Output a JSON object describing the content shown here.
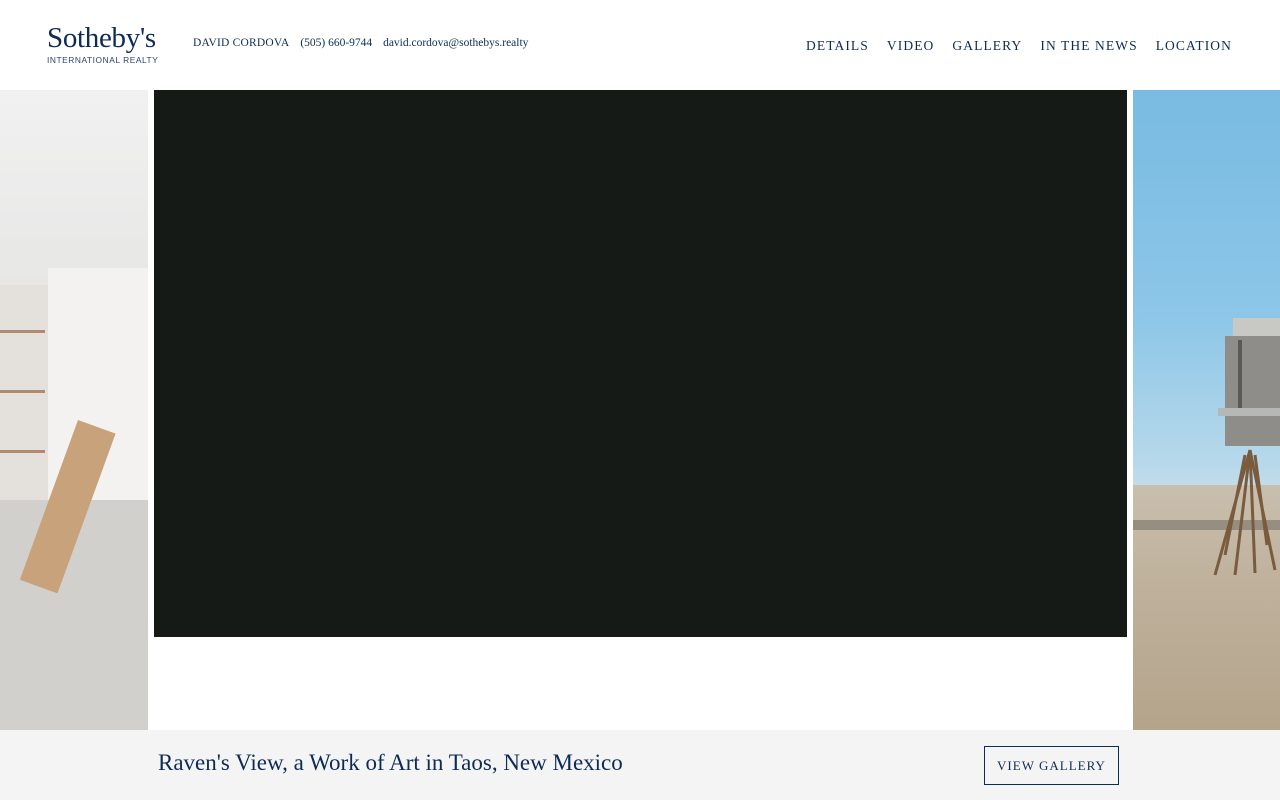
{
  "brand": {
    "wordmark": "Sotheby's",
    "subtitle": "INTERNATIONAL REALTY",
    "color": "#0e2b55"
  },
  "agent": {
    "name": "DAVID CORDOVA",
    "phone": "(505) 660-9744",
    "email": "david.cordova@sothebys.realty"
  },
  "nav": {
    "items": [
      {
        "label": "DETAILS"
      },
      {
        "label": "VIDEO"
      },
      {
        "label": "GALLERY"
      },
      {
        "label": "IN THE NEWS"
      },
      {
        "label": "LOCATION"
      }
    ]
  },
  "carousel": {
    "left_slide_icon": "interior-photo",
    "main_slide_icon": "video-player",
    "right_slide_icon": "exterior-photo"
  },
  "bottom_bar": {
    "title": "Raven's View, a Work of Art in Taos, New Mexico",
    "button_label": "VIEW GALLERY",
    "background": "#f4f4f4"
  }
}
